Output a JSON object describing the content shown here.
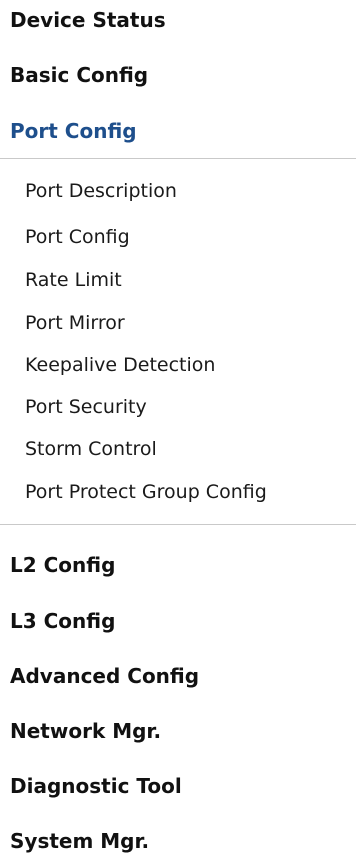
{
  "menu": {
    "top_before": [
      {
        "label": "Device Status"
      },
      {
        "label": "Basic Config"
      },
      {
        "label": "Port Config",
        "active": true
      }
    ],
    "port_config_submenu": [
      {
        "label": "Port Description"
      },
      {
        "label": "Port Config"
      },
      {
        "label": "Rate Limit"
      },
      {
        "label": "Port Mirror"
      },
      {
        "label": "Keepalive Detection"
      },
      {
        "label": "Port Security"
      },
      {
        "label": "Storm Control"
      },
      {
        "label": "Port Protect Group Config"
      }
    ],
    "top_after": [
      {
        "label": "L2 Config"
      },
      {
        "label": "L3 Config"
      },
      {
        "label": "Advanced Config"
      },
      {
        "label": "Network Mgr."
      },
      {
        "label": "Diagnostic Tool"
      },
      {
        "label": "System Mgr."
      }
    ]
  },
  "colors": {
    "active_item": "#1e4f8c",
    "text": "#111111",
    "divider": "#c9c9c9"
  }
}
